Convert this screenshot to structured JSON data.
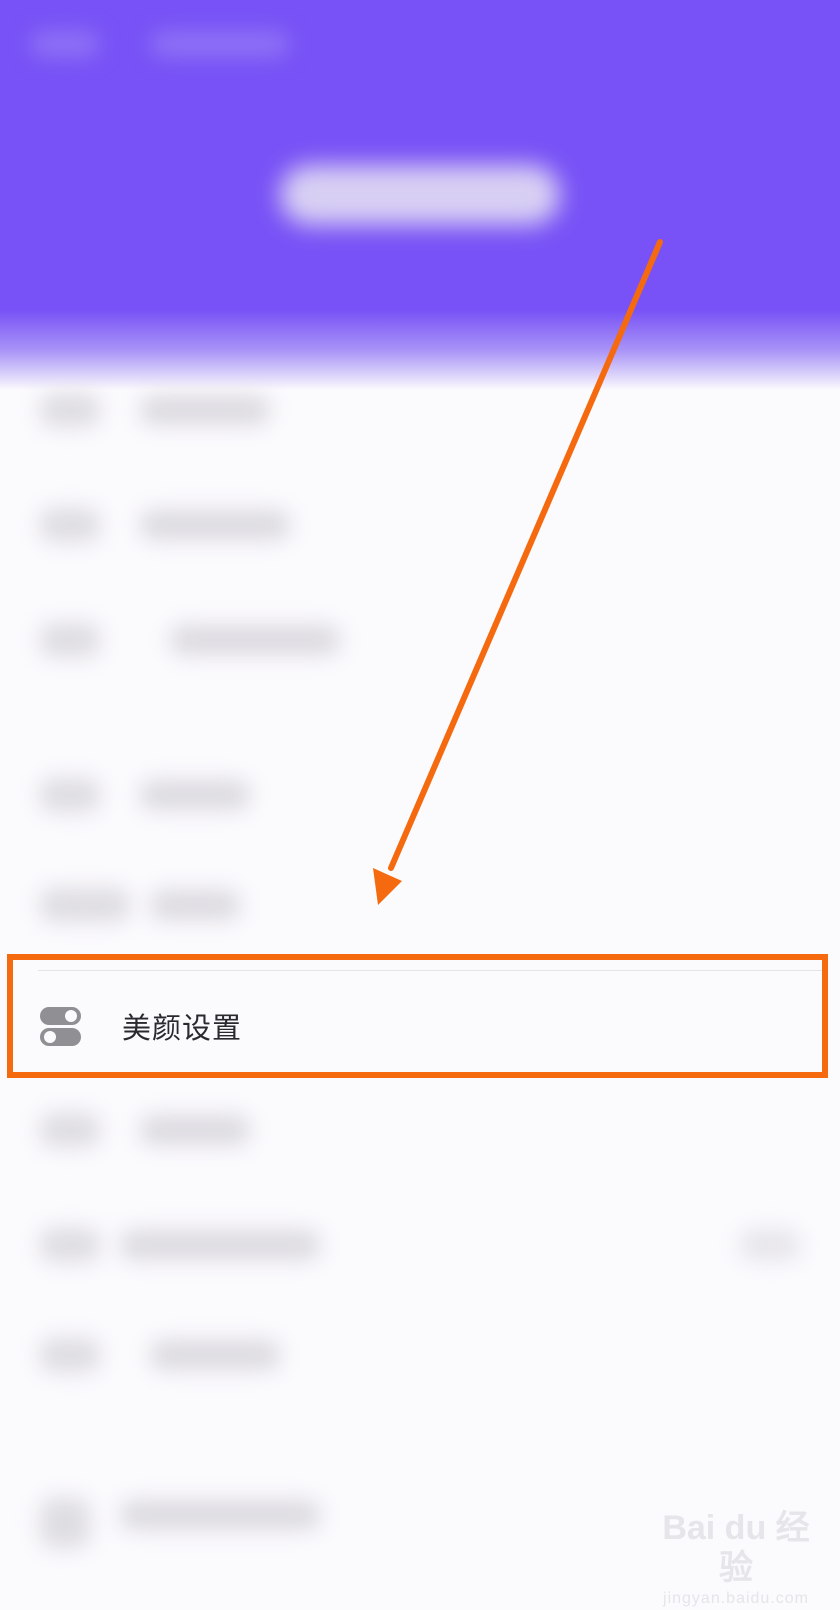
{
  "beauty_item": {
    "label": "美颜设置",
    "icon": "toggle-switches-icon"
  },
  "annotation": {
    "color": "#f56a0f"
  },
  "watermark": {
    "top": "Bai du 经验",
    "bottom": "jingyan.baidu.com"
  },
  "colors": {
    "header": "#7852f6",
    "background": "#fbfafd"
  }
}
